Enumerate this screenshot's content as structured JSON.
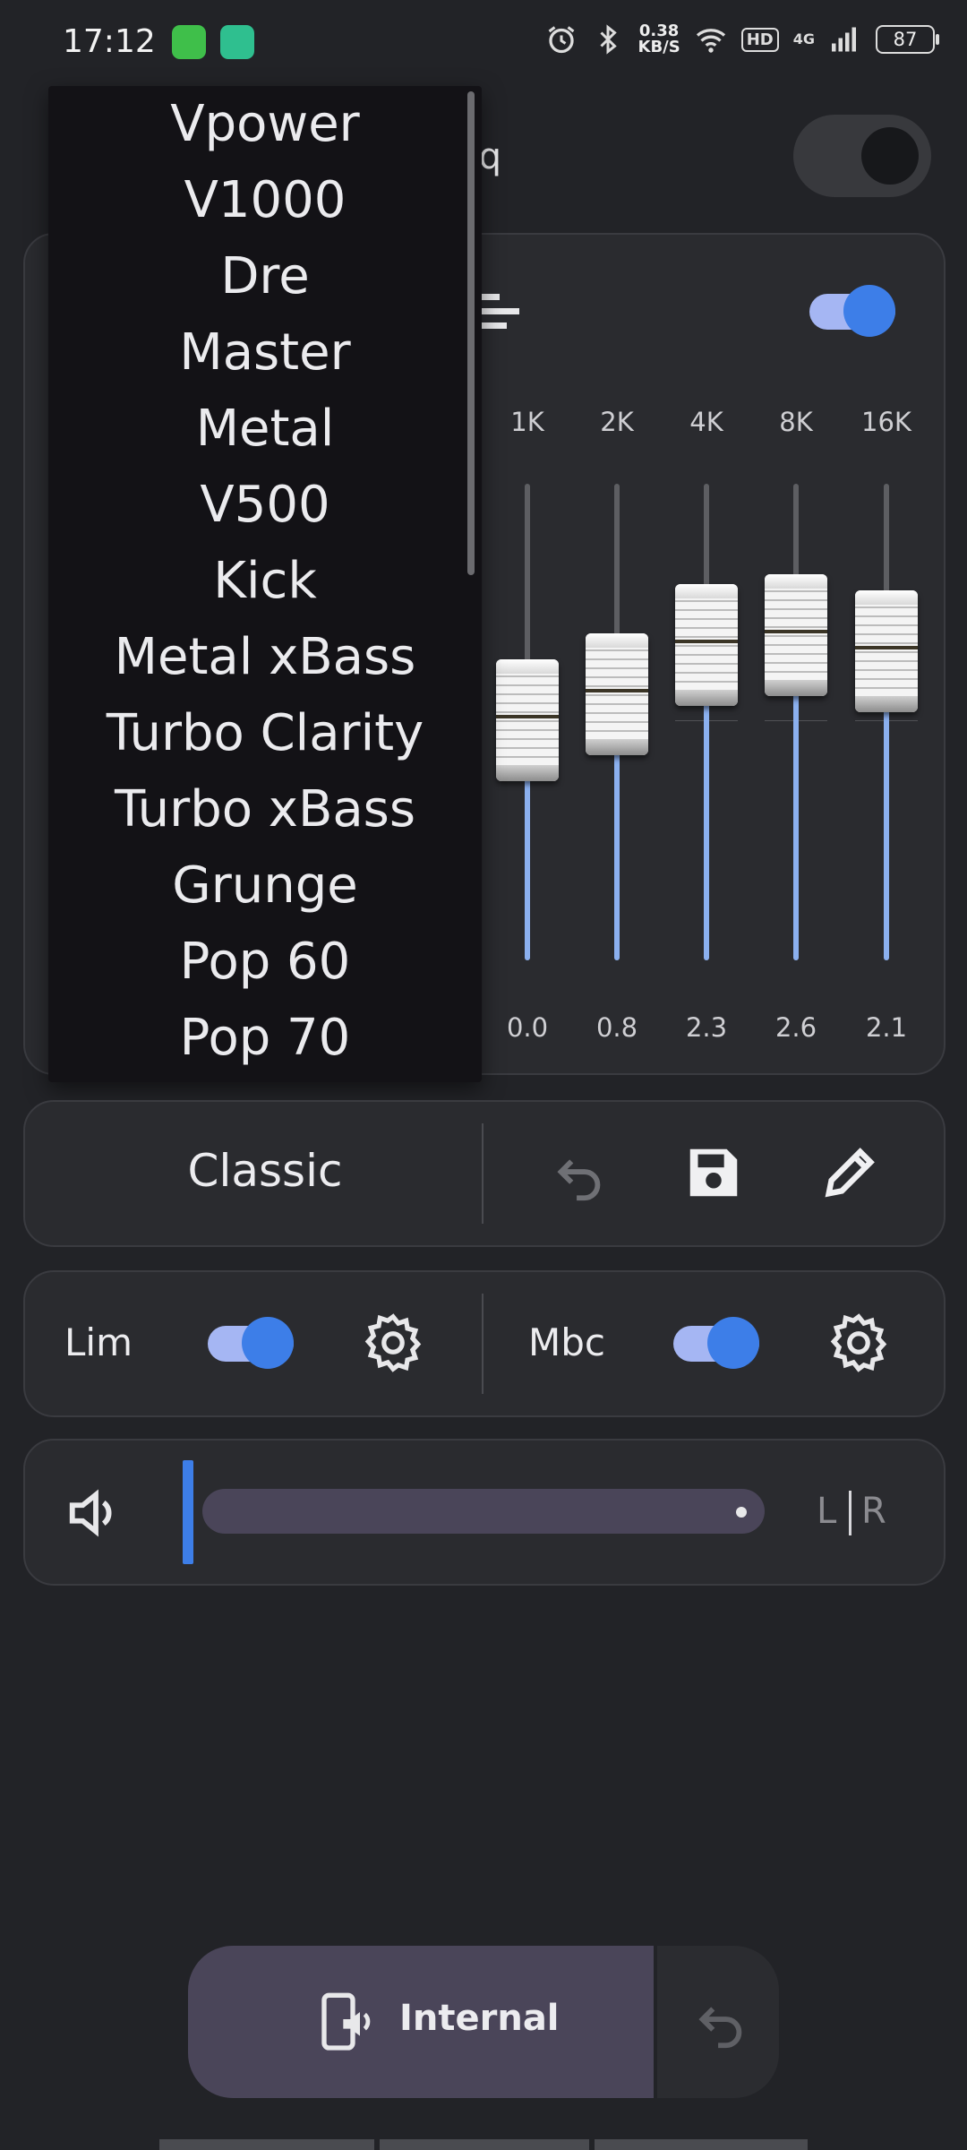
{
  "status_bar": {
    "time": "17:12",
    "net_speed_value": "0.38",
    "net_speed_unit": "KB/S",
    "hd": "HD",
    "network": "4G",
    "battery": "87"
  },
  "header": {
    "title_fragment": "eq"
  },
  "equalizer": {
    "bands": [
      {
        "label": "1K",
        "value": "0.0",
        "level": 0.0
      },
      {
        "label": "2K",
        "value": "0.8",
        "level": 0.8
      },
      {
        "label": "4K",
        "value": "2.3",
        "level": 2.3
      },
      {
        "label": "8K",
        "value": "2.6",
        "level": 2.6
      },
      {
        "label": "16K",
        "value": "2.1",
        "level": 2.1
      }
    ]
  },
  "preset_dropdown": {
    "items": [
      "Vpower",
      "V1000",
      "Dre",
      "Master",
      "Metal",
      "V500",
      "Kick",
      "Metal xBass",
      "Turbo Clarity",
      "Turbo xBass",
      "Grunge",
      "Pop 60",
      "Pop 70"
    ]
  },
  "preset_row": {
    "current": "Classic"
  },
  "dynamics": {
    "limiter_label": "Lim",
    "mbc_label": "Mbc"
  },
  "balance": {
    "left": "L",
    "right": "R"
  },
  "output": {
    "label": "Internal"
  },
  "colors": {
    "accent": "#3d7ee8",
    "accent_light": "#a5b6f3",
    "background": "#222327",
    "card": "#2a2b2f"
  }
}
